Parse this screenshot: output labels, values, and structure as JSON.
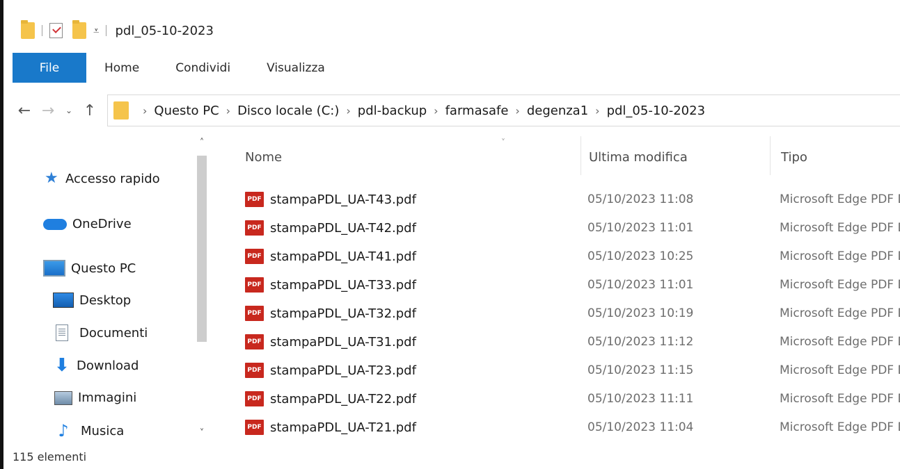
{
  "window": {
    "title": "pdl_05-10-2023"
  },
  "quick_access_toolbar": {
    "icons": [
      "folder-icon",
      "properties-icon",
      "new-folder-icon",
      "customize-dropdown-icon"
    ],
    "dropdown_glyph": "⩡"
  },
  "ribbon": {
    "tabs": [
      {
        "label": "File",
        "active": true
      },
      {
        "label": "Home"
      },
      {
        "label": "Condividi"
      },
      {
        "label": "Visualizza"
      }
    ]
  },
  "navigation_buttons": {
    "back": "←",
    "forward": "→",
    "recent": "⌄",
    "up": "↑"
  },
  "breadcrumb": [
    "Questo PC",
    "Disco locale (C:)",
    "pdl-backup",
    "farmasafe",
    "degenza1",
    "pdl_05-10-2023"
  ],
  "breadcrumb_separator": "›",
  "nav_pane": {
    "items": [
      {
        "label": "Accesso rapido",
        "icon": "star-icon"
      },
      {
        "label": "OneDrive",
        "icon": "cloud-icon"
      },
      {
        "label": "Questo PC",
        "icon": "computer-icon"
      },
      {
        "label": "Desktop",
        "icon": "desktop-icon"
      },
      {
        "label": "Documenti",
        "icon": "document-icon"
      },
      {
        "label": "Download",
        "icon": "download-arrow-icon"
      },
      {
        "label": "Immagini",
        "icon": "pictures-icon"
      },
      {
        "label": "Musica",
        "icon": "music-note-icon"
      }
    ],
    "scroll_up": "˄",
    "scroll_down": "˅"
  },
  "file_list": {
    "columns": [
      "Nome",
      "Ultima modifica",
      "Tipo"
    ],
    "sort_indicator": "˅",
    "file_icon_label": "PDF",
    "rows": [
      {
        "name": "stampaPDL_UA-T43.pdf",
        "modified": "05/10/2023 11:08",
        "type": "Microsoft Edge PDF Document"
      },
      {
        "name": "stampaPDL_UA-T42.pdf",
        "modified": "05/10/2023 11:01",
        "type": "Microsoft Edge PDF Document"
      },
      {
        "name": "stampaPDL_UA-T41.pdf",
        "modified": "05/10/2023 10:25",
        "type": "Microsoft Edge PDF Document"
      },
      {
        "name": "stampaPDL_UA-T33.pdf",
        "modified": "05/10/2023 11:01",
        "type": "Microsoft Edge PDF Document"
      },
      {
        "name": "stampaPDL_UA-T32.pdf",
        "modified": "05/10/2023 10:19",
        "type": "Microsoft Edge PDF Document"
      },
      {
        "name": "stampaPDL_UA-T31.pdf",
        "modified": "05/10/2023 11:12",
        "type": "Microsoft Edge PDF Document"
      },
      {
        "name": "stampaPDL_UA-T23.pdf",
        "modified": "05/10/2023 11:15",
        "type": "Microsoft Edge PDF Document"
      },
      {
        "name": "stampaPDL_UA-T22.pdf",
        "modified": "05/10/2023 11:11",
        "type": "Microsoft Edge PDF Document"
      },
      {
        "name": "stampaPDL_UA-T21.pdf",
        "modified": "05/10/2023 11:04",
        "type": "Microsoft Edge PDF Document"
      }
    ]
  },
  "status_bar": {
    "item_count": "115 elementi"
  },
  "colors": {
    "file_tab": "#1979ca",
    "folder": "#f5c44b",
    "pdf_icon": "#c8281e",
    "accent_blue": "#1f7fe0"
  }
}
